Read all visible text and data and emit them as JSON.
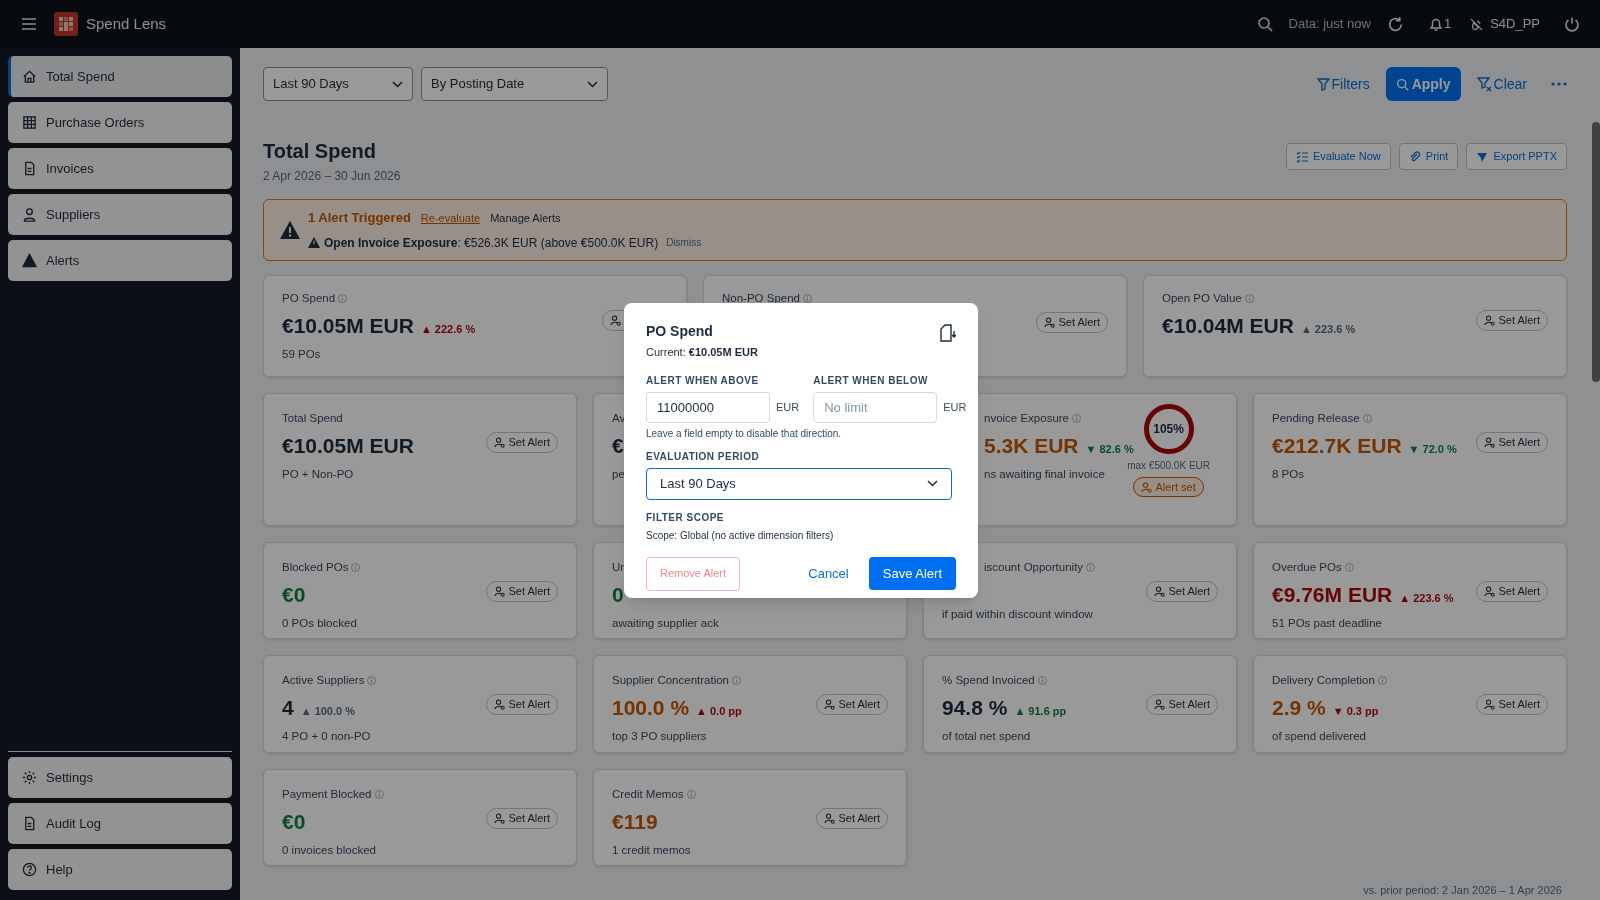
{
  "header": {
    "app_name": "Spend Lens",
    "data_status": "Data: just now",
    "notifications": "1",
    "system": "S4D_PP"
  },
  "sidebar": {
    "items": [
      {
        "label": "Total Spend",
        "selected": true
      },
      {
        "label": "Purchase Orders",
        "selected": false
      },
      {
        "label": "Invoices",
        "selected": false
      },
      {
        "label": "Suppliers",
        "selected": false
      },
      {
        "label": "Alerts",
        "selected": false
      }
    ],
    "bottom_items": [
      {
        "label": "Settings",
        "selected": false
      },
      {
        "label": "Audit Log",
        "selected": false
      },
      {
        "label": "Help",
        "selected": false
      }
    ]
  },
  "toolbar": {
    "period": "Last 90 Days",
    "date_basis": "By Posting Date",
    "filters": "Filters",
    "apply": "Apply",
    "clear": "Clear"
  },
  "page": {
    "title": "Total Spend",
    "date_range": "2 Apr 2026 – 30 Jun 2026",
    "actions": [
      "Evaluate Now",
      "Print",
      "Export PPTX"
    ]
  },
  "alert_banner": {
    "title": "1 Alert Triggered",
    "reevaluate": "Re-evaluate",
    "manage": "Manage Alerts",
    "message": "**Open Invoice Exposure**: €526.3K EUR (above €500.0K EUR)",
    "dismiss": "Dismiss"
  },
  "kpi_rows": [
    [
      {
        "kind": "full",
        "title": "PO Spend",
        "info": true,
        "value": {
          "text": "€10.05M EUR",
          "color": "#111b25"
        },
        "delta": {
          "text": "▲ 222.6 %",
          "color": "#660505"
        },
        "sub": "59 POs",
        "button": {
          "kind": "set_alert"
        }
      },
      {
        "kind": "full",
        "title": "Non-PO Spend",
        "info": true,
        "button": {
          "kind": "set_alert",
          "label": "Set Alert"
        }
      },
      {
        "kind": "full",
        "title": "Open PO Value",
        "info": true,
        "value": {
          "text": "€10.04M EUR",
          "color": "#111b25"
        },
        "delta": {
          "text": "▲ 223.6 %",
          "color": "#33404e"
        },
        "button": {
          "kind": "set_alert",
          "label": "Set Alert"
        }
      }
    ],
    [
      {
        "kind": "full",
        "title": "Total Spend",
        "value": {
          "text": "€10.05M EUR",
          "color": "#111b25"
        },
        "sub": "PO + Non-PO",
        "button": {
          "kind": "set_alert",
          "label": "Set Alert"
        }
      },
      {
        "kind": "full",
        "title": "Av",
        "value": {
          "text": "€",
          "color": "#111b25"
        },
        "sub": "pe"
      },
      {
        "kind": "covered_left",
        "title": "nvoice Exposure",
        "info": true,
        "value": {
          "text": "5.3K EUR",
          "color": "#753300"
        },
        "delta": {
          "text": "▼ 82.6 %",
          "color": "#0a4c25"
        },
        "sub": "ns awaiting final invoice",
        "gauge": {
          "label": "105%",
          "caption": "max €500.0K EUR"
        },
        "button": {
          "kind": "alert_set",
          "label": "Alert set"
        }
      },
      {
        "kind": "full",
        "title": "Pending Release",
        "info": true,
        "value": {
          "text": "€212.7K EUR",
          "color": "#753300"
        },
        "delta": {
          "text": "▼ 72.0 %",
          "color": "#0a4c25"
        },
        "sub": "8 POs",
        "button": {
          "kind": "set_alert",
          "label": "Set Alert"
        }
      }
    ],
    [
      {
        "kind": "full",
        "title": "Blocked POs",
        "info": true,
        "value": {
          "text": "€0",
          "color": "#0a4c25"
        },
        "sub": "0 POs blocked",
        "button": {
          "kind": "set_alert",
          "label": "Set Alert"
        }
      },
      {
        "kind": "full",
        "title": "Ur",
        "value": {
          "text": "0",
          "color": "#0a4c25"
        },
        "sub": "awaiting supplier ack"
      },
      {
        "kind": "covered_top",
        "title": "iscount Opportunity",
        "info": true,
        "sub": "if paid within discount window",
        "button": {
          "kind": "set_alert",
          "label": "Set Alert"
        }
      },
      {
        "kind": "full",
        "title": "Overdue POs",
        "info": true,
        "value": {
          "text": "€9.76M EUR",
          "color": "#660505"
        },
        "delta": {
          "text": "▲ 223.6 %",
          "color": "#660505"
        },
        "sub": "51 POs past deadline",
        "button": {
          "kind": "set_alert",
          "label": "Set Alert"
        }
      }
    ],
    [
      {
        "kind": "full",
        "title": "Active Suppliers",
        "info": true,
        "value": {
          "text": "4",
          "color": "#111b25"
        },
        "delta": {
          "text": "▲ 100.0 %",
          "color": "#33404e"
        },
        "sub": "4 PO + 0 non-PO",
        "button": {
          "kind": "set_alert",
          "label": "Set Alert"
        }
      },
      {
        "kind": "full",
        "title": "Supplier Concentration",
        "info": true,
        "value": {
          "text": "100.0 %",
          "color": "#753300"
        },
        "delta": {
          "text": "▲ 0.0 pp",
          "color": "#660505"
        },
        "sub": "top 3 PO suppliers",
        "button": {
          "kind": "set_alert",
          "label": "Set Alert"
        }
      },
      {
        "kind": "full",
        "title": "% Spend Invoiced",
        "info": true,
        "value": {
          "text": "94.8 %",
          "color": "#111b25"
        },
        "delta": {
          "text": "▲ 91.6 pp",
          "color": "#0a4c25"
        },
        "sub": "of total net spend",
        "button": {
          "kind": "set_alert",
          "label": "Set Alert"
        }
      },
      {
        "kind": "full",
        "title": "Delivery Completion",
        "info": true,
        "value": {
          "text": "2.9 %",
          "color": "#753300"
        },
        "delta": {
          "text": "▼ 0.3 pp",
          "color": "#660505"
        },
        "sub": "of spend delivered",
        "button": {
          "kind": "set_alert",
          "label": "Set Alert"
        }
      }
    ],
    [
      {
        "kind": "full",
        "title": "Payment Blocked",
        "info": true,
        "value": {
          "text": "€0",
          "color": "#0a4c25"
        },
        "sub": "0 invoices blocked",
        "button": {
          "kind": "set_alert",
          "label": "Set Alert"
        }
      },
      {
        "kind": "full",
        "title": "Credit Memos",
        "info": true,
        "value": {
          "text": "€119",
          "color": "#753300"
        },
        "sub": "1 credit memos",
        "button": {
          "kind": "set_alert",
          "label": "Set Alert"
        }
      }
    ]
  ],
  "footer_note": "vs. prior period: 2 Jan 2026 – 1 Apr 2026",
  "dialog": {
    "title": "PO Spend",
    "current": "Current: **€10.05M EUR**",
    "above_label": "ALERT WHEN ABOVE",
    "above_value": "11000000",
    "above_unit": "EUR",
    "below_label": "ALERT WHEN BELOW",
    "below_placeholder": "No limit",
    "below_unit": "EUR",
    "hint": "Leave a field empty to disable that direction.",
    "period_label": "EVALUATION PERIOD",
    "period_value": "Last 90 Days",
    "scope_label": "FILTER SCOPE",
    "scope_text": "Scope: Global (no active dimension filters)",
    "remove": "Remove Alert",
    "remove_disabled": true,
    "cancel": "Cancel",
    "save": "Save Alert"
  }
}
